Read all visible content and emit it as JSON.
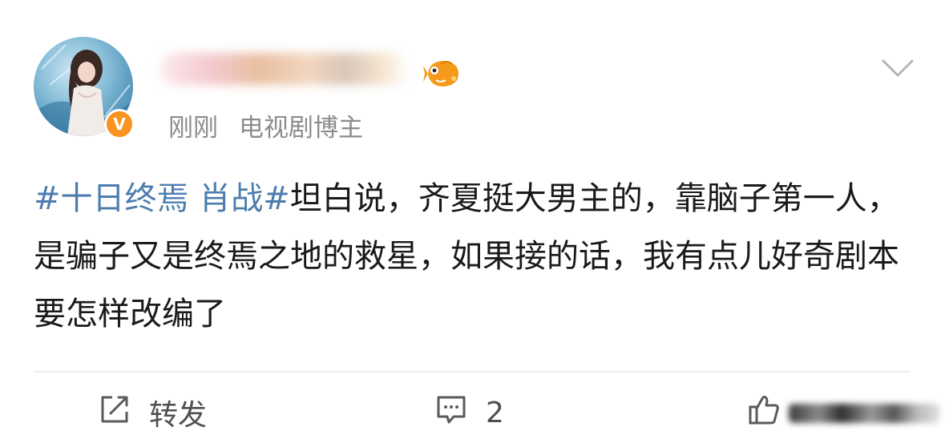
{
  "post": {
    "time": "刚刚",
    "source": "电视剧博主",
    "verified_badge": "V",
    "topic": "#十日终焉 肖战#",
    "body": "坦白说，齐夏挺大男主的，靠脑子第一人，是骗子又是终焉之地的救星，如果接的话，我有点儿好奇剧本要怎样改编了"
  },
  "actions": {
    "repost_label": "转发",
    "comment_count": "2"
  },
  "icons": {
    "avatar": "avatar",
    "verified": "verified-badge-icon",
    "fish": "fish-icon",
    "more": "chevron-down-icon",
    "repost": "share-icon",
    "comment": "comment-icon",
    "like": "thumbs-up-icon"
  },
  "colors": {
    "topic": "#4d7dae",
    "meta": "#8c8c8c",
    "verified": "#f7931e",
    "text": "#1a1a1a"
  }
}
